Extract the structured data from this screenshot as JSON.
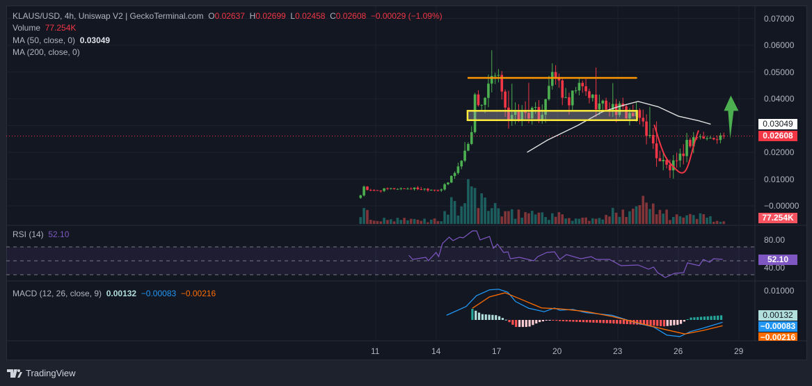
{
  "header": {
    "symbol_line": "KLAUS/USD, 4h, Uniswap V2 | GeckoTerminal.com",
    "o_label": "O",
    "o": "0.02637",
    "h_label": "H",
    "h": "0.02699",
    "l_label": "L",
    "l": "0.02458",
    "c_label": "C",
    "c": "0.02608",
    "change": "−0.00029 (−1.09%)"
  },
  "volume_legend": {
    "label": "Volume",
    "value": "77.254K"
  },
  "ma50_legend": {
    "label": "MA (50, close, 0)",
    "value": "0.03049"
  },
  "ma200_legend": {
    "label": "MA (200, close, 0)"
  },
  "rsi_legend": {
    "label": "RSI (14)",
    "value": "52.10"
  },
  "macd_legend": {
    "label": "MACD (12, 26, close, 9)",
    "hist": "0.00132",
    "macd": "−0.00083",
    "signal": "−0.00216"
  },
  "badges": {
    "ma50": "0.03049",
    "last_price": "0.02608",
    "volume": "77.254K",
    "rsi": "52.10",
    "macd_hist": "0.00132",
    "macd": "−0.00083",
    "signal": "−0.00216"
  },
  "colors": {
    "up": "#4caf50",
    "down": "#f23645",
    "ma50": "#e0e0e0",
    "rsi": "#7e57c2",
    "macd": "#2196f3",
    "signal": "#ff6d00",
    "resistance": "#ff9800",
    "support_zone": "#ffeb3b",
    "arrow": "#4caf50"
  },
  "footer": {
    "brand": "TradingView"
  },
  "chart_data": {
    "type": "candlestick",
    "interval": "4h",
    "price_axis": {
      "labels": [
        "0.07000",
        "0.06000",
        "0.05000",
        "0.04000",
        "0.02000",
        "0.01000",
        "−0.00000"
      ],
      "values": [
        0.07,
        0.06,
        0.05,
        0.04,
        0.02,
        0.01,
        0.0
      ]
    },
    "time_axis": {
      "labels": [
        "11",
        "14",
        "17",
        "20",
        "23",
        "26",
        "29"
      ],
      "days": [
        11,
        14,
        17,
        20,
        23,
        26,
        29
      ]
    },
    "close_keypoints": [
      [
        10.25,
        0.004
      ],
      [
        10.35,
        0.008
      ],
      [
        10.6,
        0.0055
      ],
      [
        12,
        0.0065
      ],
      [
        13,
        0.0065
      ],
      [
        14.2,
        0.006
      ],
      [
        14.5,
        0.0075
      ],
      [
        14.8,
        0.0115
      ],
      [
        15.2,
        0.016
      ],
      [
        15.5,
        0.022
      ],
      [
        15.7,
        0.026
      ],
      [
        15.9,
        0.04
      ],
      [
        16.3,
        0.038
      ],
      [
        16.8,
        0.048
      ],
      [
        17.2,
        0.046
      ],
      [
        17.6,
        0.032
      ],
      [
        18.5,
        0.035
      ],
      [
        19.2,
        0.034
      ],
      [
        19.6,
        0.047
      ],
      [
        20.0,
        0.048
      ],
      [
        20.5,
        0.036
      ],
      [
        21,
        0.045
      ],
      [
        21.5,
        0.042
      ],
      [
        22,
        0.038
      ],
      [
        23,
        0.036
      ],
      [
        23.7,
        0.034
      ],
      [
        24.2,
        0.032
      ],
      [
        24.6,
        0.025
      ],
      [
        25,
        0.018
      ],
      [
        25.5,
        0.014
      ],
      [
        26.0,
        0.015
      ],
      [
        26.3,
        0.022
      ],
      [
        26.8,
        0.026
      ],
      [
        27.5,
        0.025
      ],
      [
        28.2,
        0.02608
      ]
    ],
    "volume_keypoints": [
      [
        10.25,
        20
      ],
      [
        11,
        6
      ],
      [
        14.3,
        6
      ],
      [
        14.6,
        28
      ],
      [
        15.2,
        22
      ],
      [
        15.8,
        55
      ],
      [
        16.3,
        35
      ],
      [
        17,
        24
      ],
      [
        17.3,
        12
      ],
      [
        18.5,
        18
      ],
      [
        19.6,
        14
      ],
      [
        20.5,
        10
      ],
      [
        22,
        6
      ],
      [
        24.3,
        35
      ],
      [
        24.6,
        25
      ],
      [
        25.2,
        30
      ],
      [
        25.6,
        12
      ],
      [
        26.5,
        10
      ],
      [
        27,
        14
      ],
      [
        28.2,
        3
      ]
    ],
    "ma200": [
      [
        18.5,
        0.02
      ],
      [
        19.5,
        0.0245
      ],
      [
        21,
        0.03
      ],
      [
        22.2,
        0.035
      ],
      [
        23,
        0.037
      ],
      [
        24,
        0.039
      ],
      [
        25,
        0.037
      ],
      [
        26,
        0.0335
      ],
      [
        27,
        0.0318
      ],
      [
        27.6,
        0.0305
      ]
    ],
    "annotations": {
      "resistance_line": {
        "price": 0.0478,
        "from_day": 15.55,
        "to_day": 23.95
      },
      "support_zone": {
        "top": 0.0355,
        "bottom": 0.032,
        "from_day": 15.55,
        "to_day": 23.95
      },
      "rounding_curve": [
        [
          24.8,
          0.0303
        ],
        [
          25.3,
          0.018
        ],
        [
          25.9,
          0.0135
        ],
        [
          26.5,
          0.018
        ],
        [
          27.0,
          0.0282
        ]
      ],
      "up_arrow": {
        "day": 28.6,
        "from": 0.025,
        "to": 0.0412
      }
    },
    "rsi": {
      "levels": [
        70,
        50,
        30
      ],
      "axis_labels": [
        "80.00",
        "40.00"
      ],
      "axis_values": [
        80,
        40
      ],
      "points": [
        [
          12.64,
          58
        ],
        [
          12.83,
          52
        ],
        [
          13.48,
          55
        ],
        [
          13.61,
          50
        ],
        [
          13.99,
          62
        ],
        [
          14.12,
          56
        ],
        [
          14.31,
          75
        ],
        [
          14.64,
          84
        ],
        [
          14.83,
          79
        ],
        [
          15.16,
          84
        ],
        [
          15.34,
          83
        ],
        [
          15.79,
          93
        ],
        [
          16.0,
          93
        ],
        [
          16.17,
          80
        ],
        [
          16.64,
          85
        ],
        [
          16.83,
          68
        ],
        [
          17.03,
          74
        ],
        [
          17.34,
          62
        ],
        [
          17.55,
          63
        ],
        [
          17.67,
          53
        ],
        [
          18.12,
          55
        ],
        [
          18.83,
          50
        ],
        [
          19.03,
          56
        ],
        [
          19.48,
          62
        ],
        [
          19.86,
          63
        ],
        [
          20.12,
          52
        ],
        [
          20.45,
          59
        ],
        [
          21.16,
          53
        ],
        [
          21.68,
          56
        ],
        [
          21.93,
          52
        ],
        [
          22.58,
          52
        ],
        [
          23.16,
          43
        ],
        [
          24.0,
          44
        ],
        [
          24.52,
          38
        ],
        [
          24.77,
          41
        ],
        [
          24.97,
          33
        ],
        [
          25.35,
          26
        ],
        [
          25.81,
          32
        ],
        [
          26.26,
          33
        ],
        [
          26.45,
          47
        ],
        [
          27.03,
          43
        ],
        [
          27.23,
          52
        ],
        [
          27.55,
          48
        ],
        [
          27.74,
          53
        ],
        [
          28.19,
          52.1
        ]
      ]
    },
    "macd": {
      "axis_labels": [
        "0.01000"
      ],
      "axis_values": [
        0.01
      ],
      "macd_line": [
        [
          14.51,
          0.0016
        ],
        [
          15.48,
          0.0046
        ],
        [
          15.99,
          0.0083
        ],
        [
          16.64,
          0.0103
        ],
        [
          17.09,
          0.0105
        ],
        [
          17.54,
          0.0095
        ],
        [
          17.93,
          0.0063
        ],
        [
          18.58,
          0.004
        ],
        [
          19.35,
          0.0028
        ],
        [
          19.86,
          0.0041
        ],
        [
          20.12,
          0.0033
        ],
        [
          20.77,
          0.0036
        ],
        [
          21.41,
          0.0025
        ],
        [
          22.71,
          0.0016
        ],
        [
          24.0,
          -0.0012
        ],
        [
          24.77,
          -0.0024
        ],
        [
          25.43,
          -0.0052
        ],
        [
          26.07,
          -0.0057
        ],
        [
          26.59,
          -0.004
        ],
        [
          27.23,
          -0.0028
        ],
        [
          28.19,
          -0.0008
        ]
      ],
      "signal_line": [
        [
          15.79,
          0.004
        ],
        [
          16.64,
          0.0079
        ],
        [
          17.41,
          0.0093
        ],
        [
          18.19,
          0.0071
        ],
        [
          19.22,
          0.0041
        ],
        [
          20.12,
          0.0038
        ],
        [
          21.41,
          0.0029
        ],
        [
          22.71,
          0.0012
        ],
        [
          24.0,
          -0.001
        ],
        [
          25.29,
          -0.0032
        ],
        [
          26.32,
          -0.0048
        ],
        [
          27.23,
          -0.0036
        ],
        [
          28.19,
          -0.002
        ]
      ],
      "histogram": [
        [
          15.79,
          0.0038
        ],
        [
          16.25,
          0.002
        ],
        [
          17.03,
          0.0016
        ],
        [
          17.48,
          0.0
        ],
        [
          17.93,
          -0.0024
        ],
        [
          18.58,
          -0.0024
        ],
        [
          19.09,
          -0.0008
        ],
        [
          19.61,
          0.0
        ],
        [
          20.12,
          -0.0004
        ],
        [
          21.41,
          -0.0008
        ],
        [
          22.71,
          -0.0012
        ],
        [
          24.0,
          -0.0016
        ],
        [
          25.29,
          -0.0022
        ],
        [
          26.07,
          -0.0016
        ],
        [
          26.45,
          0.0002
        ],
        [
          26.59,
          0.0008
        ],
        [
          28.19,
          0.0016
        ]
      ]
    }
  }
}
